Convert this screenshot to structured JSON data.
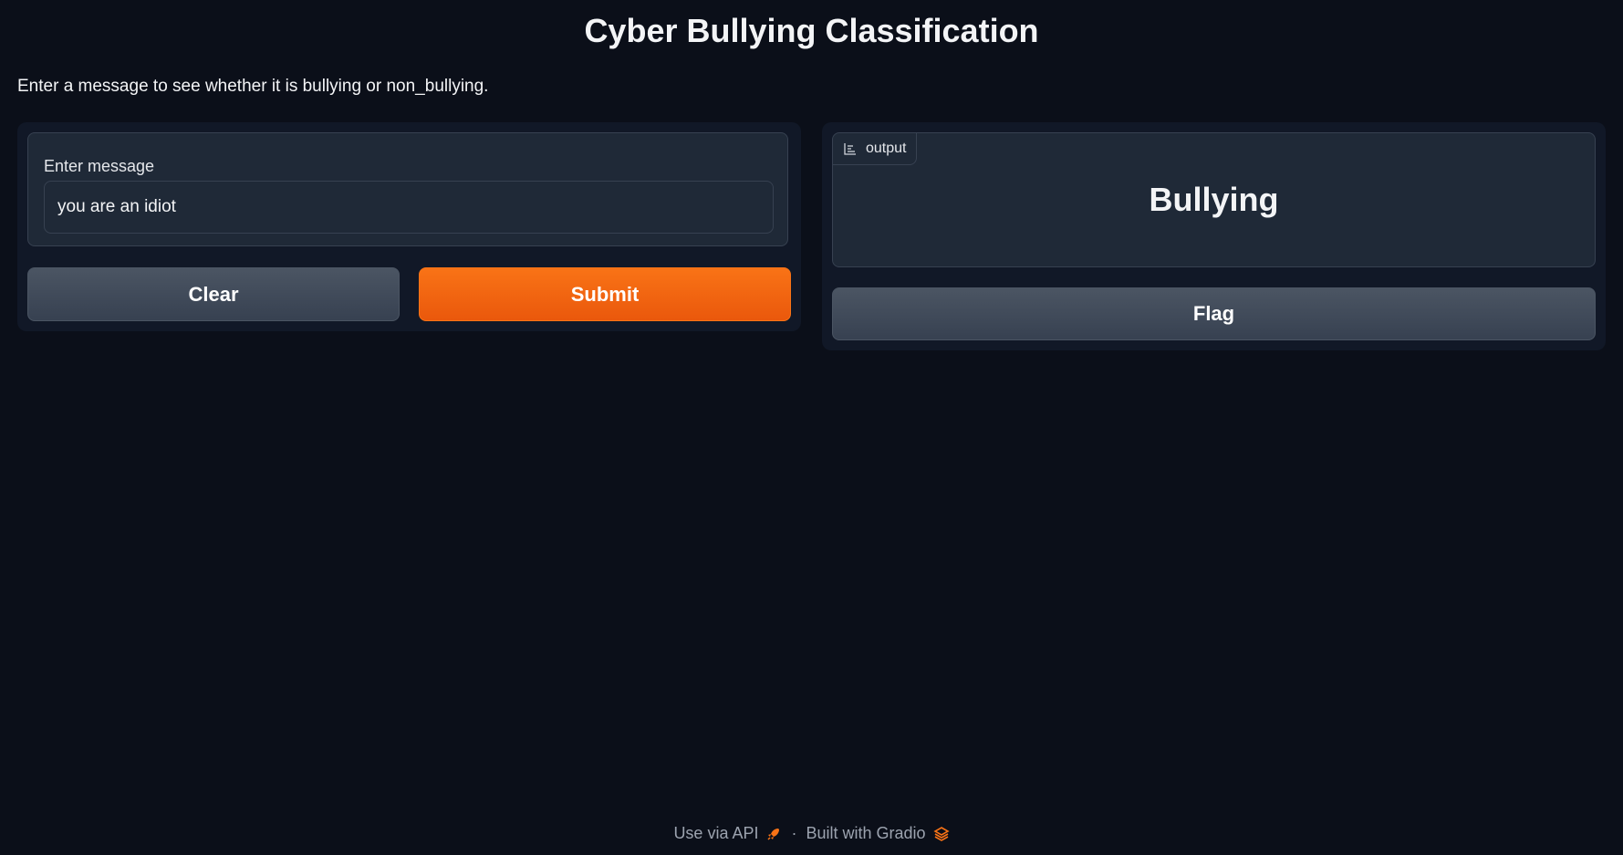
{
  "page": {
    "title": "Cyber Bullying Classification",
    "description": "Enter a message to see whether it is bullying or non_bullying."
  },
  "input": {
    "label": "Enter message",
    "value": "you are an idiot"
  },
  "buttons": {
    "clear": "Clear",
    "submit": "Submit",
    "flag": "Flag"
  },
  "output": {
    "label": "output",
    "icon": "bar-chart-icon",
    "value": "Bullying"
  },
  "footer": {
    "api_link": "Use via API",
    "separator": "·",
    "built_with": "Built with Gradio",
    "api_icon": "rocket-icon",
    "gradio_icon": "gradio-logo-icon"
  },
  "colors": {
    "background": "#0b0f19",
    "panel": "#111827",
    "block": "#1f2937",
    "accent": "#f97316"
  }
}
